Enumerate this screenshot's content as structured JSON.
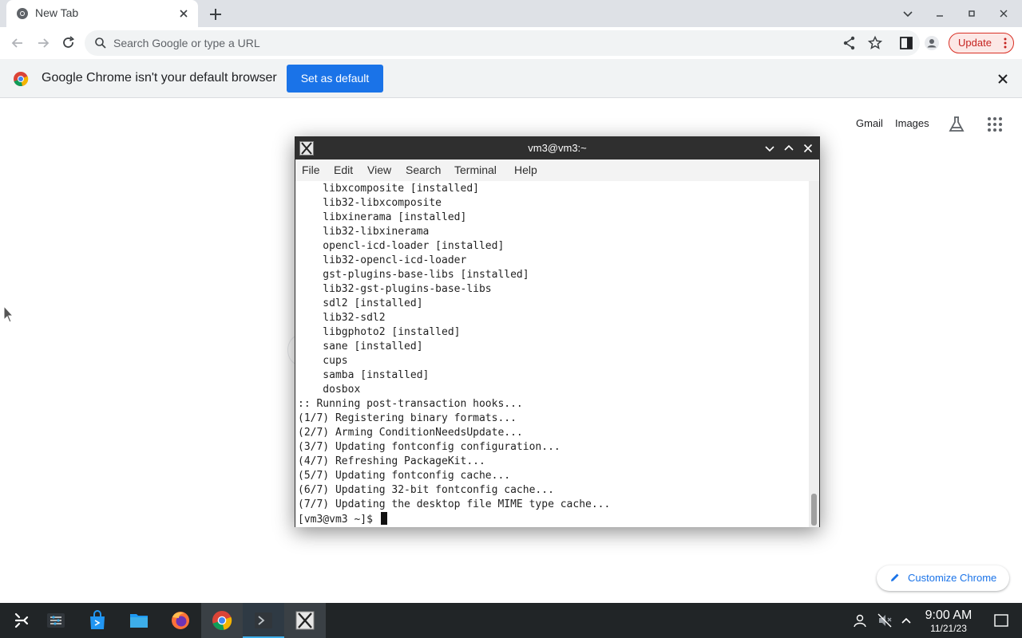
{
  "browser": {
    "tab": {
      "title": "New Tab"
    },
    "omnibox": {
      "placeholder": "Search Google or type a URL"
    },
    "update_label": "Update",
    "infobar": {
      "message": "Google Chrome isn't your default browser",
      "button_label": "Set as default"
    },
    "ntp": {
      "links": [
        "Gmail",
        "Images"
      ],
      "customize_label": "Customize Chrome"
    },
    "colors": {
      "accent": "#1a73e8",
      "update_red": "#c5221f"
    }
  },
  "terminal": {
    "title": "vm3@vm3:~",
    "menu": [
      "File",
      "Edit",
      "View",
      "Search",
      "Terminal",
      "Help"
    ],
    "lines": [
      "    libxcomposite [installed]",
      "    lib32-libxcomposite",
      "    libxinerama [installed]",
      "    lib32-libxinerama",
      "    opencl-icd-loader [installed]",
      "    lib32-opencl-icd-loader",
      "    gst-plugins-base-libs [installed]",
      "    lib32-gst-plugins-base-libs",
      "    sdl2 [installed]",
      "    lib32-sdl2",
      "    libgphoto2 [installed]",
      "    sane [installed]",
      "    cups",
      "    samba [installed]",
      "    dosbox",
      ":: Running post-transaction hooks...",
      "(1/7) Registering binary formats...",
      "(2/7) Arming ConditionNeedsUpdate...",
      "(3/7) Updating fontconfig configuration...",
      "(4/7) Refreshing PackageKit...",
      "(5/7) Updating fontconfig cache...",
      "(6/7) Updating 32-bit fontconfig cache...",
      "(7/7) Updating the desktop file MIME type cache..."
    ],
    "prompt": "[vm3@vm3 ~]$ "
  },
  "taskbar": {
    "apps": [
      "app-launcher",
      "system-settings",
      "discover-store",
      "file-manager",
      "firefox",
      "google-chrome",
      "konsole",
      "xterm"
    ],
    "clock": {
      "time": "9:00 AM",
      "date": "11/21/23"
    }
  }
}
